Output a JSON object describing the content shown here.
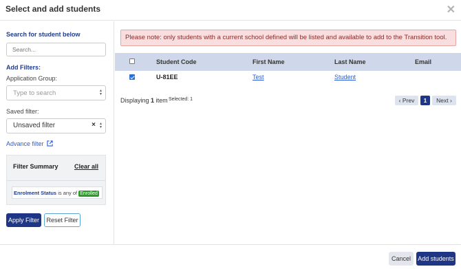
{
  "dialog": {
    "title": "Select and add students",
    "close_glyph": "✕"
  },
  "sidebar": {
    "search_label": "Search for student below",
    "search_placeholder": "Search...",
    "add_filters_label": "Add Filters:",
    "application_group_label": "Application Group:",
    "application_group_placeholder": "Type to search",
    "saved_filter_label": "Saved filter:",
    "saved_filter_value": "Unsaved filter",
    "advance_filter_label": "Advance filter",
    "summary": {
      "title": "Filter Summary",
      "clear_all": "Clear all",
      "criteria_field": "Enrolment Status",
      "criteria_op": "is any of",
      "criteria_value": "Enrolled"
    },
    "apply_button": "Apply Filter",
    "reset_button": "Reset Filter"
  },
  "notice": "Please note: only students with a current school defined will be listed and available to add to the Transition tool.",
  "table": {
    "columns": [
      "Student Code",
      "First Name",
      "Last Name",
      "Email"
    ],
    "rows": [
      {
        "checked": true,
        "code": "U-81EE",
        "first": "Test",
        "last": "Student",
        "email": ""
      }
    ]
  },
  "status": {
    "displaying_prefix": "Displaying",
    "count": "1",
    "item_word": "item",
    "selected": "Selected: 1"
  },
  "pagination": {
    "prev": "‹ Prev",
    "page": "1",
    "next": "Next ›"
  },
  "footer": {
    "cancel": "Cancel",
    "add": "Add students"
  },
  "colors": {
    "primary": "#1f3586",
    "link": "#2a5bd7",
    "notice_bg": "#f8dede",
    "enrolled_badge": "#2e9a2e"
  }
}
